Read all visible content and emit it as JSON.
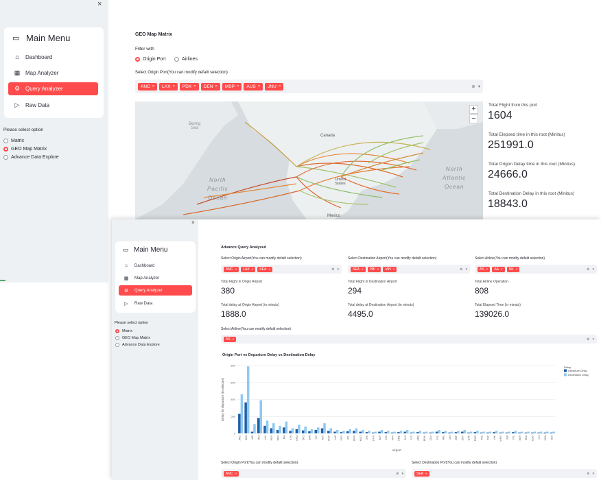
{
  "screenA": {
    "close_icon_char": "×",
    "sidebar": {
      "menu_title": "Main Menu",
      "items": [
        {
          "label": "Dashboard",
          "icon": "house-icon",
          "active": false
        },
        {
          "label": "Map Analyzer",
          "icon": "map-icon",
          "active": false
        },
        {
          "label": "Query Analyzer",
          "icon": "gear-icon",
          "active": true
        },
        {
          "label": "Raw Data",
          "icon": "play-icon",
          "active": false
        }
      ],
      "option_label": "Please select option",
      "options": [
        {
          "label": "Matrix",
          "selected": false
        },
        {
          "label": "GEO Map Matrix",
          "selected": true
        },
        {
          "label": "Advance Data Explore",
          "selected": false
        }
      ]
    },
    "main": {
      "title": "GEO Map Matrix",
      "filter_label": "Filter with",
      "filter_options": [
        {
          "label": "Origin Port",
          "selected": true
        },
        {
          "label": "Airlines",
          "selected": false
        }
      ],
      "select_label": "Select Origin Port(You can modify defailt selection)",
      "tags": [
        "ANC",
        "LAX",
        "PDX",
        "DEN",
        "MSP",
        "AUS",
        "JNU"
      ],
      "map_labels": {
        "bering": "Bering\nSea",
        "north_pacific": "North\nPacific\nOcean",
        "north_atlantic": "North\nAtlantic\nOcean",
        "canada": "Canada",
        "united_states": "United\nStates",
        "mexico": "Mexico"
      },
      "metrics": [
        {
          "label": "Total Flight from this port",
          "value": "1604"
        },
        {
          "label": "Total Elepsed time in this root (Minitus)",
          "value": "251991.0"
        },
        {
          "label": "Total Origon Delay time in this root (Minitus)",
          "value": "24666.0"
        },
        {
          "label": "Total Destination Delay in this root (Minitus)",
          "value": "18843.0"
        }
      ]
    }
  },
  "screenB": {
    "close_icon_char": "×",
    "sidebar": {
      "menu_title": "Main Menu",
      "items": [
        {
          "label": "Dashboard",
          "icon": "house-icon",
          "active": false
        },
        {
          "label": "Map Analyzer",
          "icon": "map-icon",
          "active": false
        },
        {
          "label": "Query Analyzer",
          "icon": "gear-icon",
          "active": true
        },
        {
          "label": "Raw Data",
          "icon": "play-icon",
          "active": false
        }
      ],
      "option_label": "Please select option",
      "options": [
        {
          "label": "Matrix",
          "selected": true
        },
        {
          "label": "GEO Map Matrix",
          "selected": false
        },
        {
          "label": "Advance Data Explore",
          "selected": false
        }
      ]
    },
    "main": {
      "title": "Advance Query Analyzed",
      "origin_select_label": "Select Origin Airport(You can modify defailt selection)",
      "origin_tags": [
        "ANC",
        "LAX",
        "SEA"
      ],
      "dest_select_label": "Select Destination Airport(You can modify defailt selection)",
      "dest_tags": [
        "SEA",
        "PBI",
        "IAH"
      ],
      "airline_select_label": "Select Airline(You can modify defailt selection)",
      "airline_tags": [
        "AS",
        "AA",
        "NK"
      ],
      "metrics": [
        {
          "label": "Total Flight in Origin Airport",
          "value": "380"
        },
        {
          "label": "Total Flight in Destination Airport",
          "value": "294"
        },
        {
          "label": "Total Airline Operation",
          "value": "808"
        },
        {
          "label": "Total delay at Origin Airport (in minuts)",
          "value": "1888.0"
        },
        {
          "label": "Total delay at Destination Airport (in minuts)",
          "value": "4495.0"
        },
        {
          "label": "Total Elapsed Time (in minuts)",
          "value": "139026.0"
        }
      ],
      "airline2_select_label": "Select Airline(You can modify defailt selection)",
      "airline2_tags": [
        "AS"
      ],
      "bottom_origin_label": "Select Origin Port(You can modify defailt selection)",
      "bottom_origin_tags": [
        "ANC"
      ],
      "bottom_dest_label": "Select Destination Port(You can modify defailt selection)",
      "bottom_dest_tags": [
        "SEA"
      ]
    }
  },
  "chart_data": {
    "type": "bar",
    "title": "Origin Port vs Departure Delay vs Destination Delay",
    "xlabel": "Airport",
    "ylabel": "Delay for departure (in Minutes)",
    "ylim": [
      0,
      800
    ],
    "yticks": [
      0,
      200,
      400,
      600,
      800
    ],
    "legend_title": "Delay",
    "legend_position": "top-right",
    "categories": [
      "ANC",
      "SEA",
      "IAD",
      "JNU",
      "LAX",
      "BOS",
      "DEN",
      "FAI",
      "KTN",
      "ORD",
      "SFO",
      "SAN",
      "SIT",
      "PDX",
      "MSP",
      "LAS",
      "PSG",
      "ATL",
      "DFW",
      "MCO",
      "JFK",
      "DTW",
      "BET",
      "SJC",
      "PHX",
      "OME",
      "SLC",
      "OTZ",
      "ADQ",
      "BRW",
      "CDV",
      "FLL",
      "HNL",
      "IAH",
      "SMF",
      "ONT",
      "OAK",
      "EWR",
      "PHL",
      "PSP",
      "YAK",
      "WRG",
      "LGB",
      "STL",
      "BUR",
      "SNA",
      "OGG",
      "LIH",
      "KOA",
      "BOI"
    ],
    "series": [
      {
        "name": "Departure Delay",
        "color": "#1f5fa8",
        "values": [
          230,
          365,
          20,
          180,
          90,
          60,
          40,
          70,
          30,
          50,
          35,
          25,
          40,
          60,
          30,
          20,
          15,
          25,
          30,
          20,
          15,
          10,
          20,
          15,
          10,
          15,
          20,
          10,
          15,
          10,
          10,
          20,
          15,
          10,
          15,
          20,
          10,
          15,
          10,
          10,
          15,
          10,
          10,
          15,
          10,
          10,
          10,
          10,
          10,
          10
        ]
      },
      {
        "name": "Destination Delay",
        "color": "#8fc9f0",
        "values": [
          460,
          790,
          110,
          390,
          150,
          120,
          90,
          140,
          60,
          100,
          80,
          50,
          70,
          120,
          60,
          40,
          30,
          50,
          60,
          40,
          30,
          20,
          40,
          30,
          20,
          30,
          40,
          20,
          30,
          20,
          20,
          40,
          30,
          20,
          30,
          40,
          20,
          30,
          20,
          20,
          30,
          20,
          20,
          30,
          20,
          20,
          20,
          20,
          20,
          20
        ]
      }
    ]
  }
}
